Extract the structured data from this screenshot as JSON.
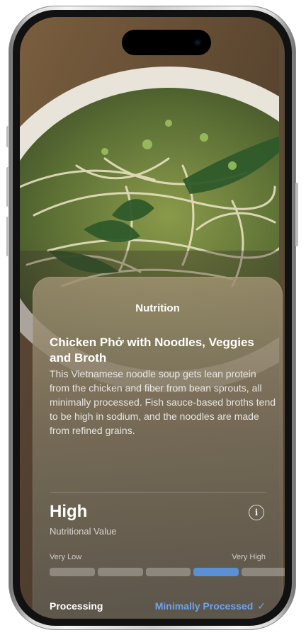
{
  "card": {
    "title": "Nutrition",
    "dish_name": "Chicken Phở with Noodles, Veggies and Broth",
    "description": "This Vietnamese noodle soup gets lean protein from the chicken and fiber from bean sprouts, all minimally processed. Fish sauce-based broths tend to be high in sodium, and the noodles are made from refined grains."
  },
  "nutrition": {
    "rating": "High",
    "rating_label": "Nutritional Value",
    "scale_low": "Very Low",
    "scale_high": "Very High",
    "level": 4,
    "levels": 5
  },
  "processing": {
    "label": "Processing",
    "value": "Minimally Processed"
  },
  "icons": {
    "info": "info-icon",
    "check": "checkmark-icon"
  },
  "colors": {
    "accent": "#5b8fd6",
    "link": "#6ea3ec"
  }
}
